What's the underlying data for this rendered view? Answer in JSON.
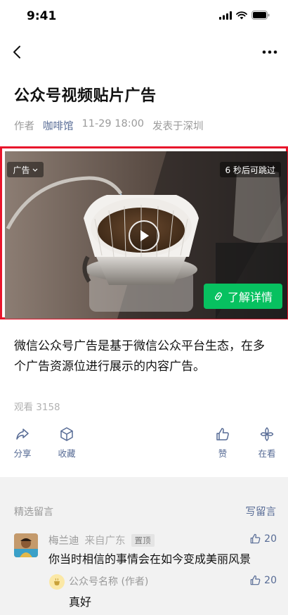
{
  "status_bar": {
    "time": "9:41"
  },
  "article": {
    "title": "公众号视频贴片广告",
    "author_label": "作者",
    "account_name": "咖啡馆",
    "datetime": "11-29 18:00",
    "location": "发表于深圳",
    "body": "微信公众号广告是基于微信公众平台生态，在多个广告资源位进行展示的内容广告。",
    "views": "观看 3158"
  },
  "ad": {
    "tag_label": "广告",
    "skip_label": "6 秒后可跳过",
    "cta_label": "了解详情",
    "accent_color": "#07c160",
    "highlight_color": "#e8142b"
  },
  "actions": {
    "share": "分享",
    "collect": "收藏",
    "like": "赞",
    "watching": "在看"
  },
  "comments": {
    "section_title": "精选留言",
    "write_label": "写留言",
    "items": [
      {
        "author": "梅兰迪",
        "location": "来自广东",
        "badge": "置顶",
        "likes": "20",
        "text": "你当时相信的事情会在如今变成美丽风景",
        "reply": {
          "author": "公众号名称 (作者)",
          "likes": "20",
          "text": "真好"
        }
      }
    ]
  }
}
